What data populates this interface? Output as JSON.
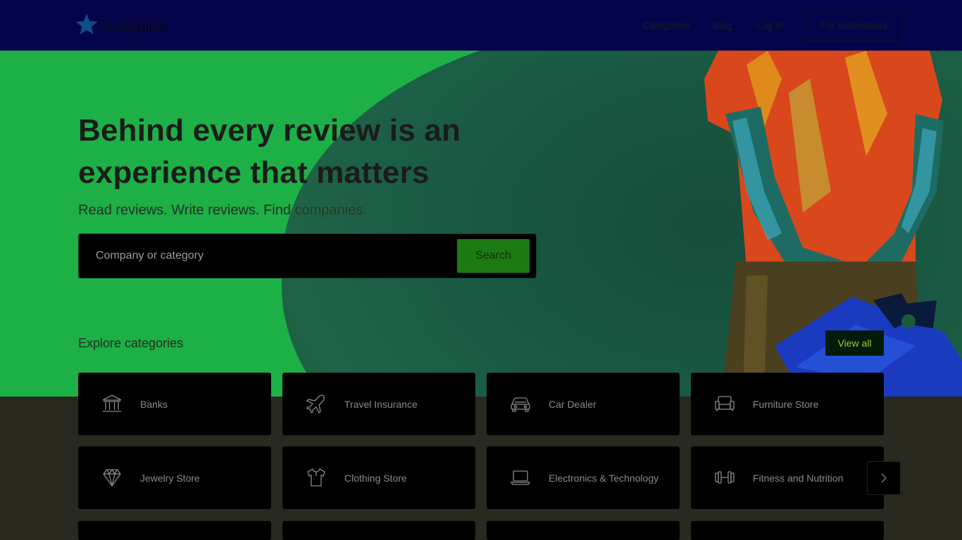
{
  "header": {
    "logo_text": "Trustpilot",
    "nav": [
      "Categories",
      "Blog",
      "Log in"
    ],
    "business_button": "For businesses"
  },
  "hero": {
    "title": "Behind every review is an experience that matters",
    "subtitle": "Read reviews. Write reviews. Find companies.",
    "search_placeholder": "Company or category",
    "search_button": "Search"
  },
  "explore": {
    "title": "Explore categories",
    "view_all": "View all",
    "categories": [
      {
        "label": "Banks",
        "icon": "bank-icon"
      },
      {
        "label": "Travel Insurance",
        "icon": "airplane-icon"
      },
      {
        "label": "Car Dealer",
        "icon": "car-icon"
      },
      {
        "label": "Furniture Store",
        "icon": "sofa-icon"
      },
      {
        "label": "Jewelry Store",
        "icon": "diamond-icon"
      },
      {
        "label": "Clothing Store",
        "icon": "tshirt-icon"
      },
      {
        "label": "Electronics & Technology",
        "icon": "laptop-icon"
      },
      {
        "label": "Fitness and Nutrition",
        "icon": "dumbbell-icon"
      }
    ]
  },
  "colors": {
    "header_bg": "#03034a",
    "hero_bg": "#1db046",
    "search_button_bg": "#1c7a12",
    "page_bg": "#2a2920"
  }
}
